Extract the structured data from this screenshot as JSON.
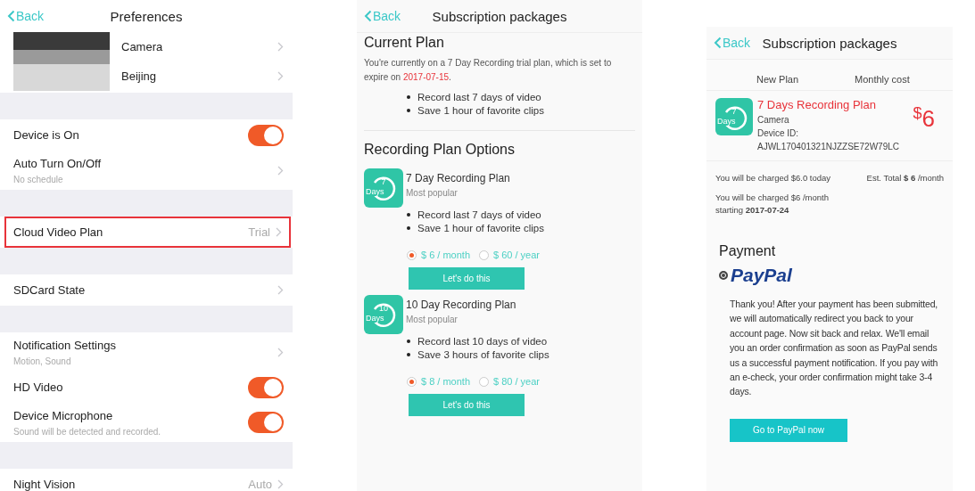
{
  "preferences": {
    "back": "Back",
    "title": "Preferences",
    "device_rows": [
      {
        "label": "Camera"
      },
      {
        "label": "Beijing"
      }
    ],
    "sections": [
      [
        {
          "kind": "toggle",
          "label": "Device is On",
          "on": true,
          "highlighted": false
        },
        {
          "kind": "link",
          "label": "Auto Turn On/Off",
          "subtitle": "No schedule",
          "highlighted": false
        }
      ],
      [
        {
          "kind": "link",
          "label": "Cloud Video Plan",
          "value": "Trial",
          "highlighted": true
        }
      ],
      [
        {
          "kind": "link",
          "label": "SDCard State",
          "highlighted": false
        }
      ],
      [
        {
          "kind": "link",
          "label": "Notification Settings",
          "subtitle": "Motion, Sound",
          "highlighted": false
        },
        {
          "kind": "toggle",
          "label": "HD Video",
          "on": true,
          "highlighted": false
        },
        {
          "kind": "toggle",
          "label": "Device Microphone",
          "subtitle": "Sound will be detected and recorded.",
          "on": true,
          "highlighted": false
        }
      ],
      [
        {
          "kind": "link",
          "label": "Night Vision",
          "value": "Auto",
          "highlighted": false
        }
      ]
    ]
  },
  "plans_screen": {
    "back": "Back",
    "title": "Subscription packages",
    "current_plan": {
      "heading": "Current Plan",
      "notice": "You're currently on a 7 Day Recording trial plan, which is set to expire on ",
      "date": "2017-07-15",
      "notice_end": ".",
      "features": [
        "Record last 7 days of video",
        "Save 1 hour of favorite clips"
      ]
    },
    "options_heading": "Recording Plan Options",
    "plans": [
      {
        "badge_number": "7",
        "badge_label": "Days",
        "name": "7 Day Recording Plan",
        "tag": "Most popular",
        "features": [
          "Record last 7 days of video",
          "Save 1 hour of favorite clips"
        ],
        "prices": [
          {
            "label": "$ 6 / month",
            "selected": true
          },
          {
            "label": "$ 60 / year",
            "selected": false
          }
        ],
        "button": "Let's do this"
      },
      {
        "badge_number": "10",
        "badge_label": "Days",
        "name": "10 Day Recording Plan",
        "tag": "Most popular",
        "features": [
          "Record last 10 days of video",
          "Save 3 hours of favorite clips"
        ],
        "prices": [
          {
            "label": "$ 8 / month",
            "selected": true
          },
          {
            "label": "$ 80 / year",
            "selected": false
          }
        ],
        "button": "Let's do this"
      }
    ]
  },
  "cart_screen": {
    "back": "Back",
    "title": "Subscription packages",
    "columns": [
      "New Plan",
      "Monthly cost"
    ],
    "item": {
      "badge_number": "7",
      "badge_label": "Days",
      "name": "7 Days Recording Plan",
      "device": "Camera",
      "device_id_label": "Device ID:",
      "device_id": "AJWL170401321NJZZSE72W79LC",
      "currency": "$",
      "amount": "6"
    },
    "charges": [
      {
        "text": "You will be charged $6.0 today"
      },
      {
        "text": "Est. Total **$ 6** /month"
      },
      {
        "text": "You will be charged $6 /month starting **2017-07-24**"
      }
    ],
    "payment_heading": "Payment",
    "payment_method": {
      "logo": "PayPal",
      "selected": true
    },
    "message": "Thank you! After your payment has been submitted, we will automatically redirect you back to your account page. Now sit back and relax. We'll email you an order confirmation as soon as PayPal sends us a successful payment notification. If you pay with an e-check, your order confirmation might take 3-4 days.",
    "button": "Go to PayPal now"
  }
}
